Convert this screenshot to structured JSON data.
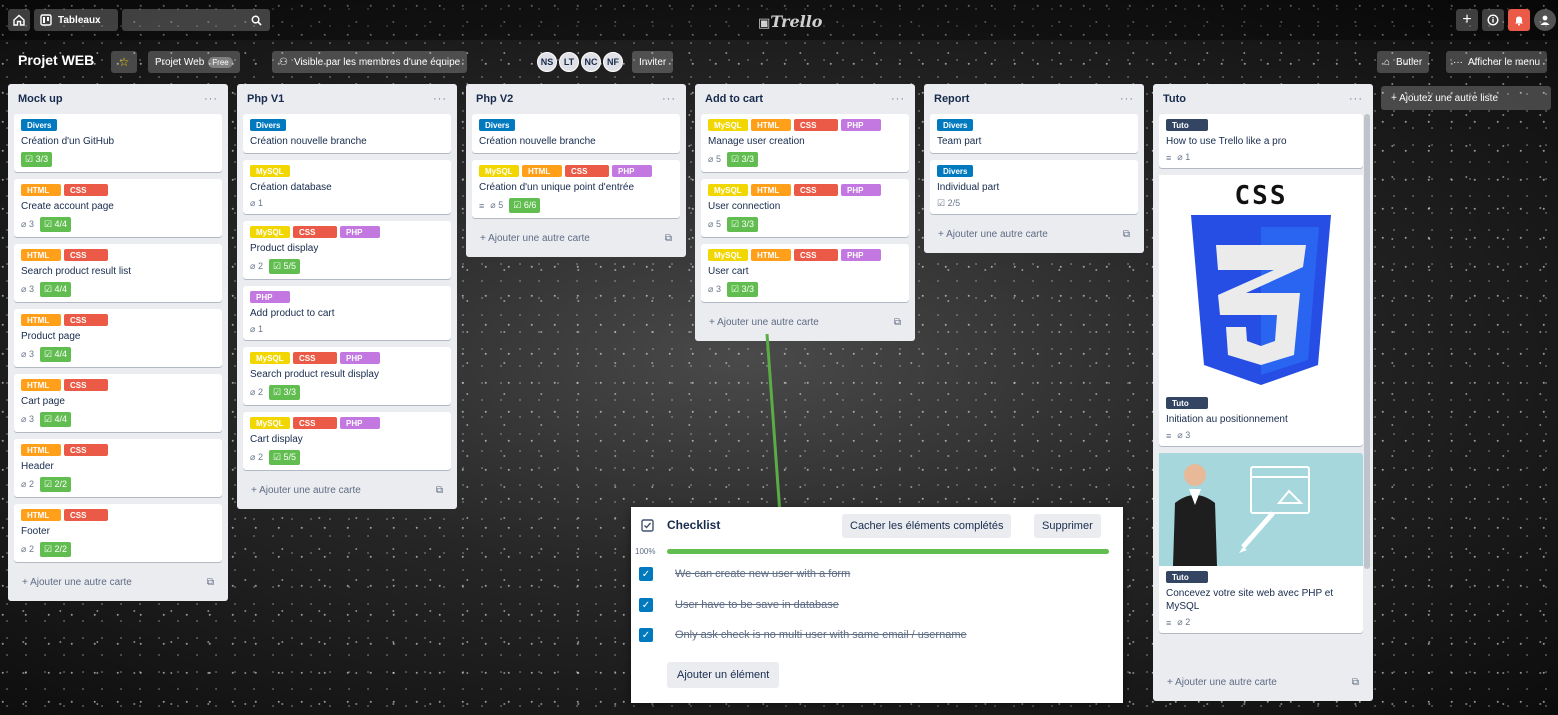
{
  "topbar": {
    "boards_label": "Tableaux",
    "logo": "Trello",
    "search_icon": "search-icon"
  },
  "board": {
    "title": "Projet WEB",
    "team": "Projet Web",
    "team_badge": "Free",
    "visibility": "Visible par les membres d'une équipe",
    "members": [
      "NS",
      "LT",
      "NC",
      "NF"
    ],
    "invite": "Inviter",
    "butler": "Butler",
    "menu": "Afficher le menu"
  },
  "lists": [
    {
      "title": "Mock up",
      "add": "+ Ajouter une autre carte",
      "cards": [
        {
          "labels": [
            "Divers"
          ],
          "title": "Création d'un GitHub",
          "checklist": "3/3"
        },
        {
          "labels": [
            "HTML",
            "CSS"
          ],
          "title": "Create account page",
          "attach": "3",
          "checklist": "4/4"
        },
        {
          "labels": [
            "HTML",
            "CSS"
          ],
          "title": "Search product result list",
          "attach": "3",
          "checklist": "4/4"
        },
        {
          "labels": [
            "HTML",
            "CSS"
          ],
          "title": "Product page",
          "attach": "3",
          "checklist": "4/4"
        },
        {
          "labels": [
            "HTML",
            "CSS"
          ],
          "title": "Cart page",
          "attach": "3",
          "checklist": "4/4"
        },
        {
          "labels": [
            "HTML",
            "CSS"
          ],
          "title": "Header",
          "attach": "2",
          "checklist": "2/2"
        },
        {
          "labels": [
            "HTML",
            "CSS"
          ],
          "title": "Footer",
          "attach": "2",
          "checklist": "2/2"
        }
      ]
    },
    {
      "title": "Php V1",
      "add": "+ Ajouter une autre carte",
      "cards": [
        {
          "labels": [
            "Divers"
          ],
          "title": "Création nouvelle branche"
        },
        {
          "labels": [
            "MySQL"
          ],
          "title": "Création database",
          "attach": "1"
        },
        {
          "labels": [
            "MySQL",
            "CSS",
            "PHP"
          ],
          "title": "Product display",
          "attach": "2",
          "checklist": "5/5"
        },
        {
          "labels": [
            "PHP"
          ],
          "title": "Add product to cart",
          "attach": "1"
        },
        {
          "labels": [
            "MySQL",
            "CSS",
            "PHP"
          ],
          "title": "Search product result display",
          "attach": "2",
          "checklist": "3/3"
        },
        {
          "labels": [
            "MySQL",
            "CSS",
            "PHP"
          ],
          "title": "Cart display",
          "attach": "2",
          "checklist": "5/5"
        }
      ]
    },
    {
      "title": "Php V2",
      "add": "+ Ajouter une autre carte",
      "cards": [
        {
          "labels": [
            "Divers"
          ],
          "title": "Création nouvelle branche"
        },
        {
          "labels": [
            "MySQL",
            "HTML",
            "CSS",
            "PHP"
          ],
          "title": "Création d'un unique point d'entrée",
          "desc": true,
          "attach": "5",
          "checklist": "6/6"
        }
      ]
    },
    {
      "title": "Add to cart",
      "add": "+ Ajouter une autre carte",
      "cards": [
        {
          "labels": [
            "MySQL",
            "HTML",
            "CSS",
            "PHP"
          ],
          "title": "Manage user creation",
          "attach": "5",
          "checklist": "3/3"
        },
        {
          "labels": [
            "MySQL",
            "HTML",
            "CSS",
            "PHP"
          ],
          "title": "User connection",
          "attach": "5",
          "checklist": "3/3"
        },
        {
          "labels": [
            "MySQL",
            "HTML",
            "CSS",
            "PHP"
          ],
          "title": "User cart",
          "attach": "3",
          "checklist": "3/3"
        }
      ]
    },
    {
      "title": "Report",
      "add": "+ Ajouter une autre carte",
      "cards": [
        {
          "labels": [
            "Divers"
          ],
          "title": "Team part"
        },
        {
          "labels": [
            "Divers"
          ],
          "title": "Individual part",
          "checklist_plain": "2/5"
        }
      ]
    },
    {
      "title": "Tuto",
      "add": "+ Ajouter une autre carte",
      "cards": [
        {
          "labels": [
            "Tuto"
          ],
          "title": "How to use Trello like a pro",
          "desc": true,
          "attach": "1"
        },
        {
          "cover": "css",
          "cover_text": "CSS",
          "labels": [
            "Tuto"
          ],
          "title": "Initiation au positionnement",
          "desc": true,
          "attach": "3"
        },
        {
          "cover": "video",
          "labels": [
            "Tuto"
          ],
          "title": "Concevez votre site web avec PHP et MySQL",
          "desc": true,
          "attach": "2"
        }
      ]
    }
  ],
  "add_list": "+ Ajoutez une autre liste",
  "checklist": {
    "title": "Checklist",
    "hide_btn": "Cacher les éléments complétés",
    "delete_btn": "Supprimer",
    "percent": "100%",
    "progress": 1.0,
    "items": [
      "We can create new user with a form",
      "User have to be save in database",
      "Only ask check is no multi user with same email / username"
    ],
    "add_btn": "Ajouter un élément"
  },
  "colors": {
    "divers": "#0079bf",
    "html": "#ff9f1a",
    "css": "#eb5a46",
    "php": "#c377e0",
    "mysql": "#f2d600",
    "tuto": "#344563",
    "green": "#61bd4f",
    "arrow": "#5aac44"
  }
}
